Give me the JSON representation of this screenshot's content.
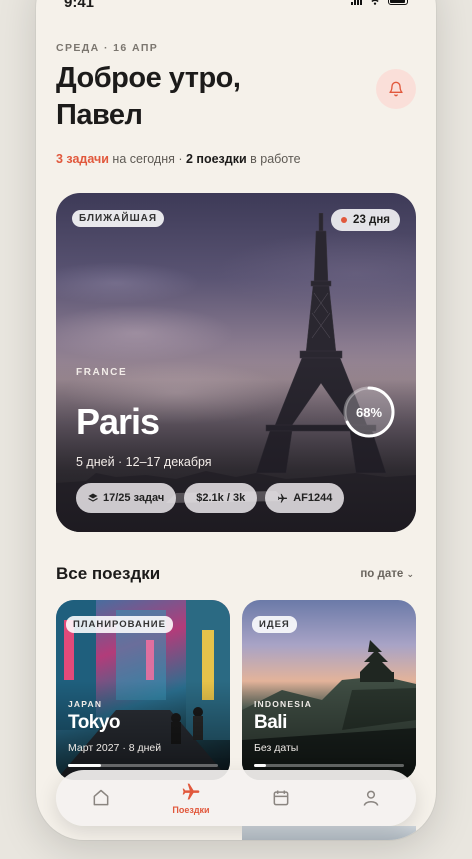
{
  "status": {
    "time": "9:41"
  },
  "header": {
    "date": "СРЕДА · 16 АПР",
    "greeting_line1": "Доброе утро,",
    "greeting_line2": "Павел",
    "summary_tasks": "3 задачи",
    "summary_mid": " на сегодня · ",
    "summary_trips": "2 поездки",
    "summary_end": " в работе"
  },
  "featured": {
    "badge": "БЛИЖАЙШАЯ",
    "countdown": "23 дня",
    "country": "FRANCE",
    "city": "Paris",
    "dates": "5 дней · 12–17 декабря",
    "progress_label": "68%",
    "progress_value": 0.68,
    "chips": {
      "tasks": "17/25 задач",
      "budget": "$2.1k / 3k",
      "flight": "AF1244"
    }
  },
  "trips": {
    "title": "Все поездки",
    "sort": "по дате",
    "items": [
      {
        "tag": "ПЛАНИРОВАНИЕ",
        "country": "JAPAN",
        "city": "Tokyo",
        "date": "Март 2027 · 8 дней",
        "progress": 0.22
      },
      {
        "tag": "ИДЕЯ",
        "country": "INDONESIA",
        "city": "Bali",
        "date": "Без даты",
        "progress": 0.08
      }
    ]
  },
  "tabbar": {
    "trips_label": "Поездки"
  },
  "colors": {
    "accent": "#e1583c",
    "background": "#f5f1ea"
  }
}
